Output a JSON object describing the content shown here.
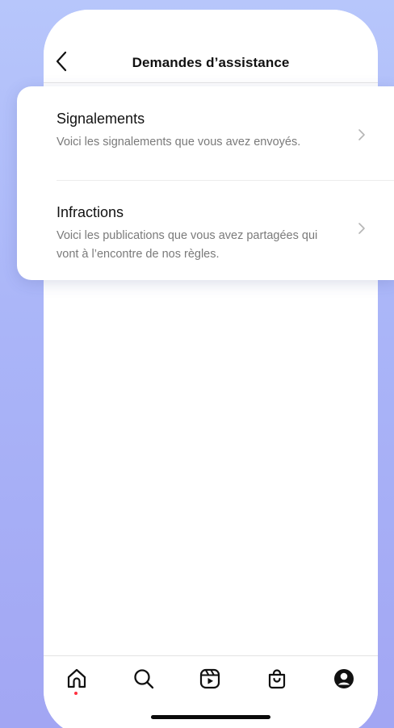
{
  "header": {
    "title": "Demandes d’assistance"
  },
  "menu": {
    "items": [
      {
        "title": "Signalements",
        "description": "Voici les signalements que vous avez envoyés."
      },
      {
        "title": "Infractions",
        "description": "Voici les publications que vous avez partagées qui vont à l’encontre de nos règles."
      }
    ]
  },
  "tabbar": {
    "tabs": [
      {
        "icon": "home-icon",
        "active": true
      },
      {
        "icon": "search-icon",
        "active": false
      },
      {
        "icon": "reels-icon",
        "active": false
      },
      {
        "icon": "shop-icon",
        "active": false
      },
      {
        "icon": "profile-icon",
        "active": false
      }
    ]
  },
  "colors": {
    "background_top": "#b7c6fb",
    "background_bottom": "#a2a6f3",
    "notification_dot": "#ff3040",
    "secondary_text": "#7a7a7a"
  }
}
